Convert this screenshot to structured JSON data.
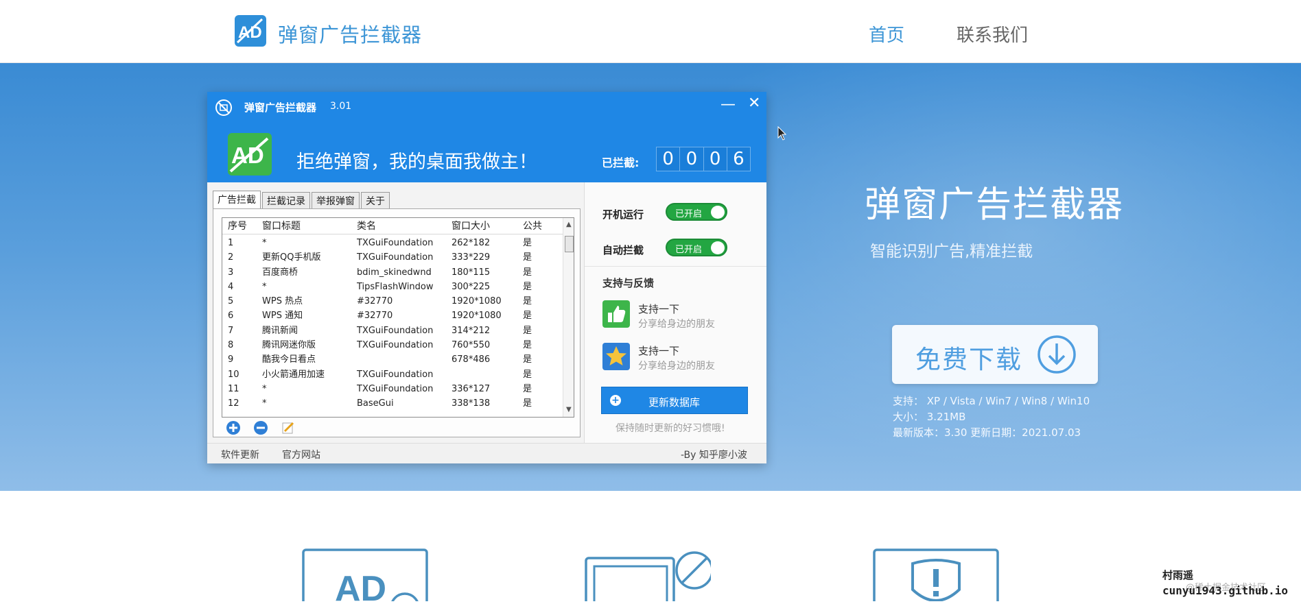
{
  "nav": {
    "brand": "弹窗广告拦截器",
    "home": "首页",
    "contact": "联系我们"
  },
  "hero": {
    "title": "弹窗广告拦截器",
    "subtitle": "智能识别广告,精准拦截",
    "download_label": "免费下载",
    "support": "支持： XP / Vista / Win7 / Win8 / Win10",
    "size": "大小： 3.21MB",
    "version": "最新版本：3.30 更新日期：2021.07.03"
  },
  "app": {
    "title": "弹窗广告拦截器",
    "version": "3.01",
    "min_glyph": "—",
    "close_glyph": "✕",
    "slogan": "拒绝弹窗，我的桌面我做主！",
    "blocked_label": "已拦截:",
    "blocked_digits": [
      "0",
      "0",
      "0",
      "6"
    ],
    "tabs": [
      "广告拦截",
      "拦截记录",
      "举报弹窗",
      "关于"
    ],
    "columns": [
      "序号",
      "窗口标题",
      "类名",
      "窗口大小",
      "公共"
    ],
    "rows": [
      [
        "1",
        "*",
        "TXGuiFoundation",
        "262*182",
        "是"
      ],
      [
        "2",
        "更新QQ手机版",
        "TXGuiFoundation",
        "333*229",
        "是"
      ],
      [
        "3",
        "百度商桥",
        "bdim_skinedwnd",
        "180*115",
        "是"
      ],
      [
        "4",
        "*",
        "TipsFlashWindow",
        "300*225",
        "是"
      ],
      [
        "5",
        "WPS 热点",
        "#32770",
        "1920*1080",
        "是"
      ],
      [
        "6",
        "WPS 通知",
        "#32770",
        "1920*1080",
        "是"
      ],
      [
        "7",
        "腾讯新闻",
        "TXGuiFoundation",
        "314*212",
        "是"
      ],
      [
        "8",
        "腾讯网迷你版",
        "TXGuiFoundation",
        "760*550",
        "是"
      ],
      [
        "9",
        "酷我今日看点",
        "",
        "678*486",
        "是"
      ],
      [
        "10",
        "小火箭通用加速",
        "TXGuiFoundation",
        "",
        "是"
      ],
      [
        "11",
        "*",
        "TXGuiFoundation",
        "336*127",
        "是"
      ],
      [
        "12",
        "*",
        "BaseGui",
        "338*138",
        "是"
      ]
    ],
    "startup_label": "开机运行",
    "startup_state": "已开启",
    "auto_label": "自动拦截",
    "auto_state": "已开启",
    "feedback_title": "支持与反馈",
    "feedback": [
      {
        "main": "支持一下",
        "sub": "分享给身边的朋友"
      },
      {
        "main": "支持一下",
        "sub": "分享给身边的朋友"
      }
    ],
    "update_btn": "更新数据库",
    "update_tip": "保持随时更新的好习惯哦!",
    "footer_update": "软件更新",
    "footer_site": "官方网站",
    "footer_author": "-By 知乎廖小波"
  },
  "watermark": {
    "line1": "村雨遥",
    "line2": "cunyu1943.github.io",
    "line3": "@稀土掘金技术社区"
  },
  "colors": {
    "brand_blue": "#3c95d6",
    "app_blue": "#1f87e5",
    "toggle_green": "#23a642"
  }
}
